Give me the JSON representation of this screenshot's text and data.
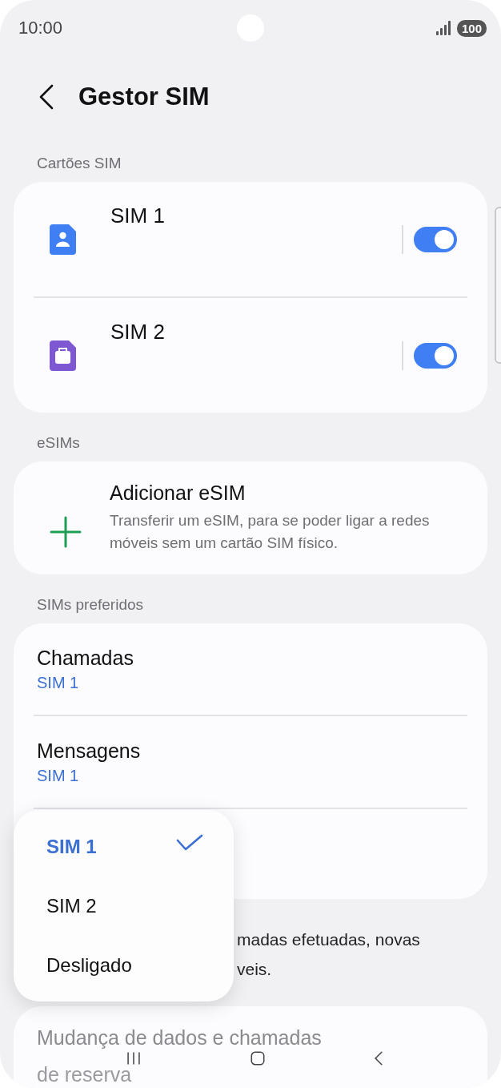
{
  "status_bar": {
    "time": "10:00",
    "battery": "100"
  },
  "header": {
    "title": "Gestor SIM"
  },
  "sim_cards": {
    "label": "Cartões SIM",
    "items": [
      {
        "name": "SIM 1",
        "kind": "personal",
        "color": "#3f7ff3",
        "on": true
      },
      {
        "name": "SIM 2",
        "kind": "work",
        "color": "#7e57d2",
        "on": true
      }
    ]
  },
  "esims": {
    "label": "eSIMs",
    "title": "Adicionar eSIM",
    "description": "Transferir um eSIM, para se poder ligar a redes móveis sem um cartão SIM físico."
  },
  "preferred": {
    "label": "SIMs preferidos",
    "items": [
      {
        "title": "Chamadas",
        "value": "SIM 1"
      },
      {
        "title": "Mensagens",
        "value": "SIM 1"
      }
    ]
  },
  "note": {
    "lines": [
      "madas efetuadas, novas",
      "veis."
    ]
  },
  "fallback": {
    "lines": [
      "Mudança de dados e chamadas",
      "de reserva"
    ]
  },
  "popup": {
    "items": [
      {
        "label": "SIM 1",
        "selected": true
      },
      {
        "label": "SIM 2",
        "selected": false
      },
      {
        "label": "Desligado",
        "selected": false
      }
    ]
  }
}
